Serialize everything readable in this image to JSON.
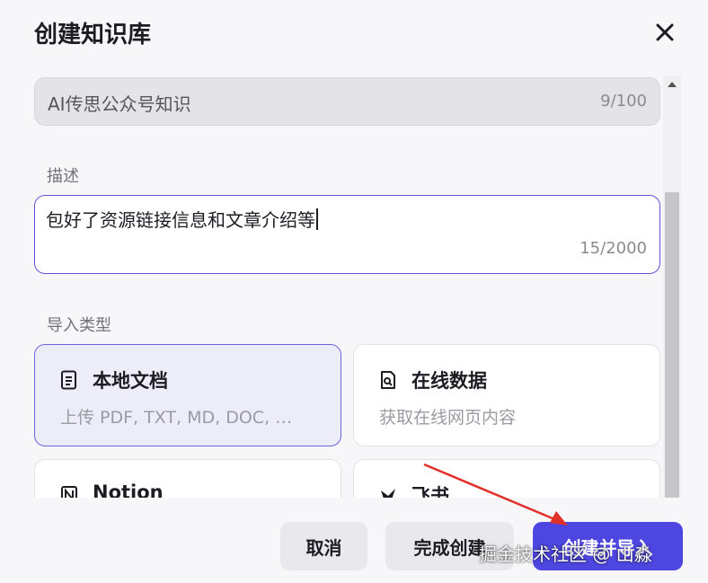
{
  "dialog": {
    "title": "创建知识库"
  },
  "name_field": {
    "value": "AI传思公众号知识",
    "counter": "9/100"
  },
  "description": {
    "label": "描述",
    "value": "包好了资源链接信息和文章介绍等",
    "counter": "15/2000"
  },
  "import_type": {
    "label": "导入类型",
    "options": [
      {
        "name": "本地文档",
        "desc": "上传 PDF, TXT, MD, DOC, …",
        "icon": "document-icon",
        "selected": true
      },
      {
        "name": "在线数据",
        "desc": "获取在线网页内容",
        "icon": "web-page-icon",
        "selected": false
      },
      {
        "name": "Notion",
        "desc": "",
        "icon": "notion-icon",
        "selected": false
      },
      {
        "name": "飞书",
        "desc": "",
        "icon": "feishu-icon",
        "selected": false
      }
    ]
  },
  "footer": {
    "cancel_label": "取消",
    "done_label": "完成创建",
    "import_label": "创建并导入"
  },
  "watermark": "掘金技术社区 @ 山淼",
  "colors": {
    "accent": "#4d46e0",
    "selected_card_bg": "#ededfa",
    "annotation_arrow": "#e0302a"
  }
}
